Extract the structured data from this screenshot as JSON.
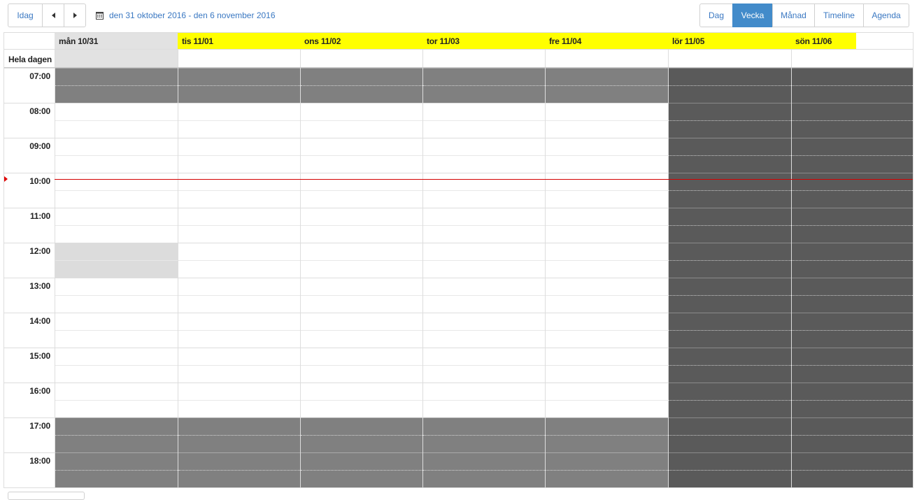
{
  "toolbar": {
    "today_label": "Idag",
    "date_range": "den 31 oktober 2016 - den 6 november 2016",
    "views": [
      "Dag",
      "Vecka",
      "Månad",
      "Timeline",
      "Agenda"
    ],
    "active_view": "Vecka"
  },
  "calendar": {
    "allday_label": "Hela dagen",
    "days": [
      {
        "label": "mån 10/31",
        "state": "today",
        "weekend": false
      },
      {
        "label": "tis 11/01",
        "state": "future",
        "weekend": false
      },
      {
        "label": "ons 11/02",
        "state": "future",
        "weekend": false
      },
      {
        "label": "tor 11/03",
        "state": "future",
        "weekend": false
      },
      {
        "label": "fre 11/04",
        "state": "future",
        "weekend": false
      },
      {
        "label": "lör 11/05",
        "state": "future",
        "weekend": true
      },
      {
        "label": "sön 11/06",
        "state": "future",
        "weekend": true
      }
    ],
    "hours": [
      "07:00",
      "08:00",
      "09:00",
      "10:00",
      "11:00",
      "12:00",
      "13:00",
      "14:00",
      "15:00",
      "16:00",
      "17:00",
      "18:00"
    ],
    "work_start": "08:00",
    "work_end": "17:00",
    "busy_block": {
      "day_index": 0,
      "start": "12:00",
      "end": "13:00"
    },
    "current_time": "10:10"
  },
  "colors": {
    "today_header": "#e2e2e2",
    "future_header": "#ffff00",
    "non_working": "#808080",
    "weekend": "#5a5a5a",
    "busy": "#dcdcdc",
    "now_indicator": "#d40000",
    "accent": "#428bca"
  }
}
